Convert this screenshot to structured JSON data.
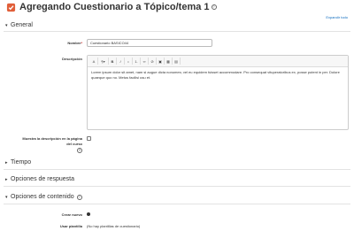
{
  "header": {
    "title": "Agregando Cuestionario a Tópico/tema 1",
    "help_glyph": "?",
    "expand_all": "Expandir todo"
  },
  "sections": {
    "general": "General",
    "tiempo": "Tiempo",
    "opciones_respuesta": "Opciones de respuesta",
    "opciones_contenido": "Opciones de contenido"
  },
  "general": {
    "name_label": "Nombre",
    "name_value": "Cuestionario BASICO44",
    "description_label": "Descripción",
    "description_text": "Lorem ipsum dolor sit amet, nam si augue dicta nonumes; vel eu equidem fuisset accommodare. Pro consequat vituperatoribus ex, posse putent in per. Dolore quaeque quo no. Metus facilisi usu et.",
    "show_description_label_1": "Muestra la descripción en la página",
    "show_description_label_2": "del curso",
    "show_description_checked": false
  },
  "toolbar": {
    "items": [
      "A",
      "¶▾",
      "B",
      "I",
      "•",
      "1.",
      "∞",
      "⊘",
      "▣",
      "▦",
      "▤"
    ]
  },
  "contenido": {
    "crear_nuevo_label": "Crear nuevo",
    "usar_plantilla_label": "Usar plantilla",
    "usar_plantilla_value": "(No hay plantillas de cuestionario)"
  },
  "colors": {
    "link": "#0f6cbf",
    "required": "#cc0000"
  }
}
